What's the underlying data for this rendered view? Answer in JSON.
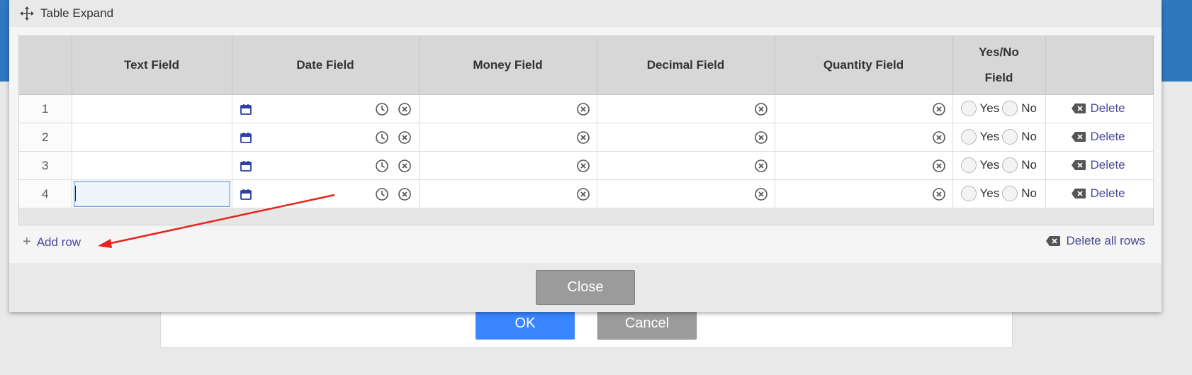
{
  "dialog": {
    "title": "Table Expand",
    "close_label": "Close"
  },
  "table": {
    "columns": [
      "",
      "Text Field",
      "Date Field",
      "Money Field",
      "Decimal Field",
      "Quantity Field",
      "Yes/No Field",
      ""
    ],
    "rows": [
      {
        "num": "1",
        "text": ""
      },
      {
        "num": "2",
        "text": ""
      },
      {
        "num": "3",
        "text": ""
      },
      {
        "num": "4",
        "text": ""
      }
    ],
    "yes_label": "Yes",
    "no_label": "No",
    "delete_label": "Delete"
  },
  "actions": {
    "add_row": "Add row",
    "delete_all": "Delete all rows"
  },
  "background": {
    "ok_label": "OK",
    "cancel_label": "Cancel"
  },
  "colors": {
    "accent_blue": "#3a86ff",
    "header_blue": "#2f78c0",
    "link": "#4a4a9a",
    "annotation_arrow": "#e8221b",
    "calendar_icon": "#2a3fa8"
  },
  "icons": [
    "move-icon",
    "calendar-icon",
    "clock-icon",
    "clear-icon",
    "backspace-icon",
    "plus-icon"
  ]
}
